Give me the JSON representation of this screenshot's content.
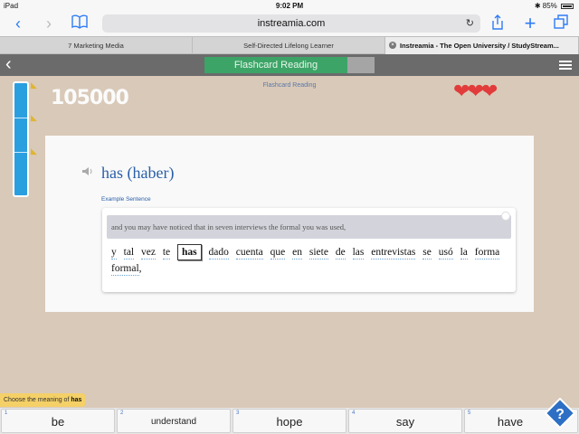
{
  "status": {
    "device": "iPad",
    "time": "9:02 PM",
    "battery": "85%"
  },
  "browser": {
    "url": "instreamia.com",
    "tabs": [
      {
        "label": "7 Marketing Media"
      },
      {
        "label": "Self-Directed Lifelong Learner"
      },
      {
        "label": "Instreamia - The Open University / StudyStream..."
      }
    ]
  },
  "app": {
    "header_title": "Flashcard Reading",
    "subtitle": "Flashcard Reading",
    "score": "105000",
    "lives": 3,
    "accent": "#3da468"
  },
  "card": {
    "word": "has (haber)",
    "example_label": "Example Sentence",
    "translation": "and you may have noticed that in seven interviews the formal you was used,",
    "sentence_words": [
      "y",
      "tal",
      "vez",
      "te",
      "has",
      "dado",
      "cuenta",
      "que",
      "en",
      "siete",
      "de",
      "las",
      "entrevistas",
      "se",
      "usó",
      "la",
      "forma",
      "formal",
      ","
    ],
    "target_word": "has"
  },
  "prompt": {
    "text": "Choose the meaning of",
    "word": "has"
  },
  "answers": [
    {
      "num": "1",
      "label": "be"
    },
    {
      "num": "2",
      "label": "understand"
    },
    {
      "num": "3",
      "label": "hope"
    },
    {
      "num": "4",
      "label": "say"
    },
    {
      "num": "5",
      "label": "have"
    }
  ]
}
